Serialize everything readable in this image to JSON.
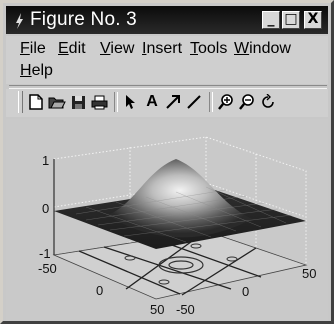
{
  "window": {
    "title": "Figure No. 3",
    "minimize_label": "_",
    "maximize_label": "□",
    "close_label": "X"
  },
  "menu": {
    "items": [
      "File",
      "Edit",
      "View",
      "Insert",
      "Tools",
      "Window",
      "Help"
    ]
  },
  "toolbar": {
    "tools": [
      {
        "icon": "new-figure-icon"
      },
      {
        "icon": "open-file-icon"
      },
      {
        "icon": "save-icon"
      },
      {
        "icon": "print-icon"
      },
      {
        "icon": "select-arrow-icon"
      },
      {
        "icon": "insert-text-icon",
        "glyph": "A"
      },
      {
        "icon": "insert-arrow-icon"
      },
      {
        "icon": "insert-line-icon"
      },
      {
        "icon": "zoom-in-icon"
      },
      {
        "icon": "zoom-out-icon"
      },
      {
        "icon": "rotate-3d-icon"
      }
    ]
  },
  "plot": {
    "type": "3d-surface-with-contour",
    "z_ticks": [
      "1",
      "0",
      "-1"
    ],
    "y_ticks": [
      "-50",
      "0",
      "50"
    ],
    "x_ticks": [
      "-50",
      "0",
      "50"
    ]
  },
  "colors": {
    "titlebar": "#111111",
    "surface_light": "#e8e8e8",
    "surface_dark": "#2a2a2a",
    "plot_background": "#c9c9c9"
  }
}
